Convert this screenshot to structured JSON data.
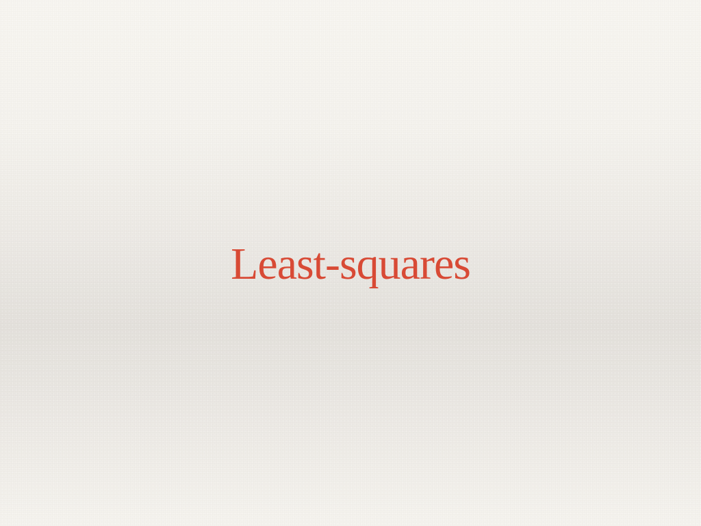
{
  "slide": {
    "title": "Least-squares"
  },
  "colors": {
    "title": "#d84a35",
    "background": "#efece7"
  }
}
